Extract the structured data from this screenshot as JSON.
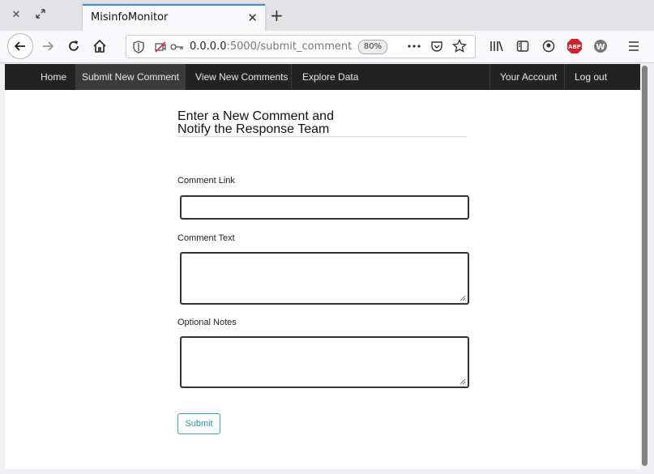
{
  "browser": {
    "tab_title": "MisinfoMonitor",
    "url_host": "0.0.0.0",
    "url_rest": ":5000/submit_comment",
    "zoom": "80%",
    "icons": [
      "close-window-icon",
      "restore-icon",
      "close-tab-icon",
      "new-tab-icon",
      "back-icon",
      "forward-icon",
      "reload-icon",
      "home-icon",
      "shield-icon",
      "camera-off-icon",
      "key-icon",
      "more-icon",
      "pocket-icon",
      "bookmark-star-icon",
      "library-icon",
      "sidebar-icon",
      "account-icon",
      "adblock-icon",
      "extension-w-icon",
      "menu-icon"
    ],
    "adblock_label": "ABP",
    "ext_label": "W"
  },
  "nav": {
    "home": "Home",
    "submit": "Submit New Comment",
    "view": "View New Comments",
    "explore": "Explore Data",
    "account": "Your Account",
    "logout": "Log out"
  },
  "form": {
    "heading_line1": "Enter a New Comment and",
    "heading_line2": "Notify the Response Team",
    "link_label": "Comment Link",
    "link_value": "",
    "text_label": "Comment Text",
    "text_value": "",
    "notes_label": "Optional Notes",
    "notes_value": "",
    "submit_label": "Submit"
  },
  "colors": {
    "tab_accent": "#3e8bd6",
    "nav_bg": "#222222",
    "submit_accent": "#2a95ad"
  }
}
